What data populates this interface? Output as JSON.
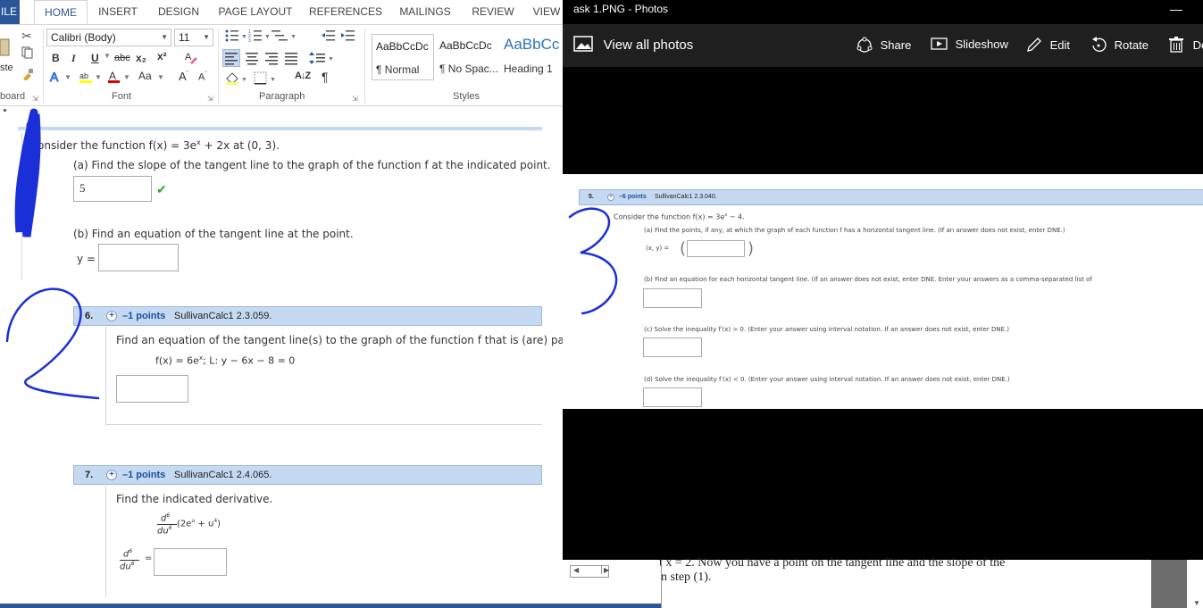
{
  "word": {
    "tabs": [
      "ILE",
      "HOME",
      "INSERT",
      "DESIGN",
      "PAGE LAYOUT",
      "REFERENCES",
      "MAILINGS",
      "REVIEW",
      "VIEW"
    ],
    "clipboard": {
      "paste_label": "ste",
      "group_label": "board"
    },
    "font": {
      "name": "Calibri (Body)",
      "size": "11",
      "bold": "B",
      "italic": "I",
      "underline": "U",
      "strike": "abc",
      "subscript": "x₂",
      "superscript": "x²",
      "case": "Aa",
      "grow": "A",
      "shrink": "A",
      "group_label": "Font"
    },
    "paragraph": {
      "group_label": "Paragraph",
      "sort": "A↓Z",
      "pilcrow": "¶"
    },
    "styles": {
      "group_label": "Styles",
      "tiles": [
        {
          "sample": "AaBbCcDc",
          "name": "¶ Normal"
        },
        {
          "sample": "AaBbCcDc",
          "name": "¶ No Spac..."
        },
        {
          "sample": "AaBbCc",
          "name": "Heading 1"
        }
      ]
    }
  },
  "doc": {
    "q5": {
      "intro": "onsider the function  f(x) = 3e",
      "intro_exp": "x",
      "intro_rest": " + 2x  at  (0, 3).",
      "part_a": "(a) Find the slope of the tangent line to the graph of the function f at the indicated point.",
      "answer_a": "5",
      "check": "✔",
      "part_b": "(b) Find an equation of the tangent line at the point.",
      "y_label": "y ="
    },
    "q6": {
      "num": "6.",
      "points": "–1 points",
      "source": "SullivanCalc1 2.3.059.",
      "text": "Find an equation of the tangent line(s) to the graph of the function f that is (are) parallel",
      "func": "f(x) = 6e",
      "func_exp": "x",
      "func_rest": ";    L: y − 6x − 8 = 0"
    },
    "q7": {
      "num": "7.",
      "points": "–1 points",
      "source": "SullivanCalc1 2.4.065.",
      "text": "Find the indicated derivative.",
      "d_num": "d",
      "d_num_exp": "6",
      "d_den": "du",
      "d_den_exp": "6",
      "expr": "(2e",
      "expr_exp": "u",
      "expr_rest": " + u",
      "expr_exp2": "4",
      "expr_close": ")",
      "eq": "="
    }
  },
  "photos": {
    "title": "ask 1.PNG - Photos",
    "minimize": "—",
    "view_all": "View all photos",
    "share": "Share",
    "slideshow": "Slideshow",
    "edit": "Edit",
    "rotate": "Rotate",
    "delete": "De",
    "image": {
      "num": "5.",
      "points": "–6 points",
      "source": "SullivanCalc1 2.3.040.",
      "intro": "Consider the function  f(x) = 3e",
      "intro_exp": "x",
      "intro_rest": " − 4.",
      "a": "(a) Find the points, if any, at which the graph of each function f has a horizontal tangent line. (If an answer does not exist, enter DNE.)",
      "xy": "(x, y) =",
      "b": "(b) Find an equation for each horizontal tangent line. (If an answer does not exist, enter DNE. Enter your answers as a comma-separated list of",
      "c": "(c) Solve the inequality  f′(x) > 0.  (Enter your answer using interval notation. If an answer does not exist, enter DNE.)",
      "d": "(d) Solve the inequality  f′(x) < 0.  (Enter your answer using interval notation. If an answer does not exist, enter DNE.)"
    }
  },
  "background_doc": {
    "line1": "t x = 2.  Now you have a point on the tangent line and the slope of the",
    "line2": "n step (1)."
  }
}
